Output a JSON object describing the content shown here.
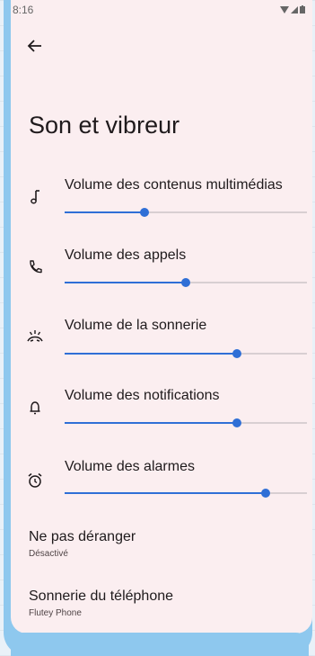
{
  "status": {
    "time": "8:16"
  },
  "page_title": "Son et vibreur",
  "volumes": [
    {
      "label": "Volume des contenus multimédias",
      "icon": "music-note-icon",
      "level": 0.33
    },
    {
      "label": "Volume des appels",
      "icon": "phone-icon",
      "level": 0.5
    },
    {
      "label": "Volume de la sonnerie",
      "icon": "ring-icon",
      "level": 0.71
    },
    {
      "label": "Volume des notifications",
      "icon": "bell-icon",
      "level": 0.71
    },
    {
      "label": "Volume des alarmes",
      "icon": "alarm-clock-icon",
      "level": 0.83
    }
  ],
  "dnd": {
    "title": "Ne pas déranger",
    "subtitle": "Désactivé"
  },
  "ringtone": {
    "title": "Sonnerie du téléphone",
    "subtitle": "Flutey Phone"
  },
  "colors": {
    "accent": "#2f6fd6",
    "background": "#fbeef0",
    "frame": "#8ec8ee"
  }
}
